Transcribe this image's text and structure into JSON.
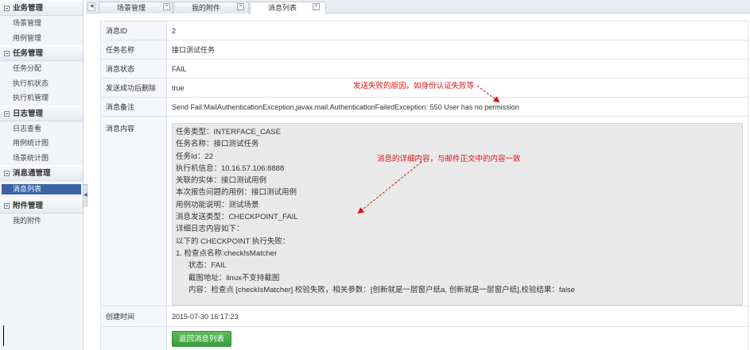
{
  "sidebar": {
    "groups": [
      {
        "title": "业务管理",
        "items": [
          "场景管理",
          "用例管理"
        ]
      },
      {
        "title": "任务管理",
        "items": [
          "任务分配",
          "执行机状态",
          "执行机管理"
        ]
      },
      {
        "title": "日志管理",
        "items": [
          "日志查看",
          "用例统计图",
          "场景统计图"
        ]
      },
      {
        "title": "消息通管理",
        "items": [
          "消息列表"
        ]
      },
      {
        "title": "附件管理",
        "items": [
          "我的附件"
        ]
      }
    ],
    "active_item": "消息列表"
  },
  "tabs": [
    {
      "label": "场景管理",
      "close": "×"
    },
    {
      "label": "我的附件",
      "close": "×"
    },
    {
      "label": "消息列表",
      "close": "×"
    }
  ],
  "detail": {
    "rows": [
      {
        "label": "消息ID",
        "value": "2"
      },
      {
        "label": "任务名称",
        "value": "接口测试任务"
      },
      {
        "label": "消息状态",
        "value": "FAIL"
      },
      {
        "label": "发送成功后删除",
        "value": "true"
      },
      {
        "label": "消息备注",
        "value": "Send Fail:MailAuthenticationException,javax.mail.AuthenticationFailedException: 550 User has no permission"
      }
    ],
    "content_label": "消息内容",
    "content_lines": [
      "任务类型：INTERFACE_CASE",
      "任务名称：接口测试任务",
      "任务Id：22",
      "执行机信息：10.16.57.106:8888",
      "关联的实体：接口测试用例",
      "本次报告问题的用例：接口测试用例",
      "用例功能说明：测试场景",
      "消息发送类型：CHECKPOINT_FAIL",
      "详细日志内容如下：",
      "以下的 CHECKPOINT 执行失败：",
      "1. 检查点名称:checkIsMatcher",
      "      状态：FAIL",
      "      截图地址：linux不支持截图",
      "      内容：检查点 [checkIsMatcher] 校验失败，相关参数：[创新就是一层窗户纸a, 创新就是一层窗户纸],校验结果：false"
    ],
    "created_label": "创建时间",
    "created_value": "2015-07-30 16:17:23",
    "back_button": "返回消息列表"
  },
  "annotations": {
    "note1": "发送失败的原因，如身份认证失败等",
    "note2": "消息的详细内容，与邮件正文中的内容一致",
    "color": "#e01010"
  }
}
